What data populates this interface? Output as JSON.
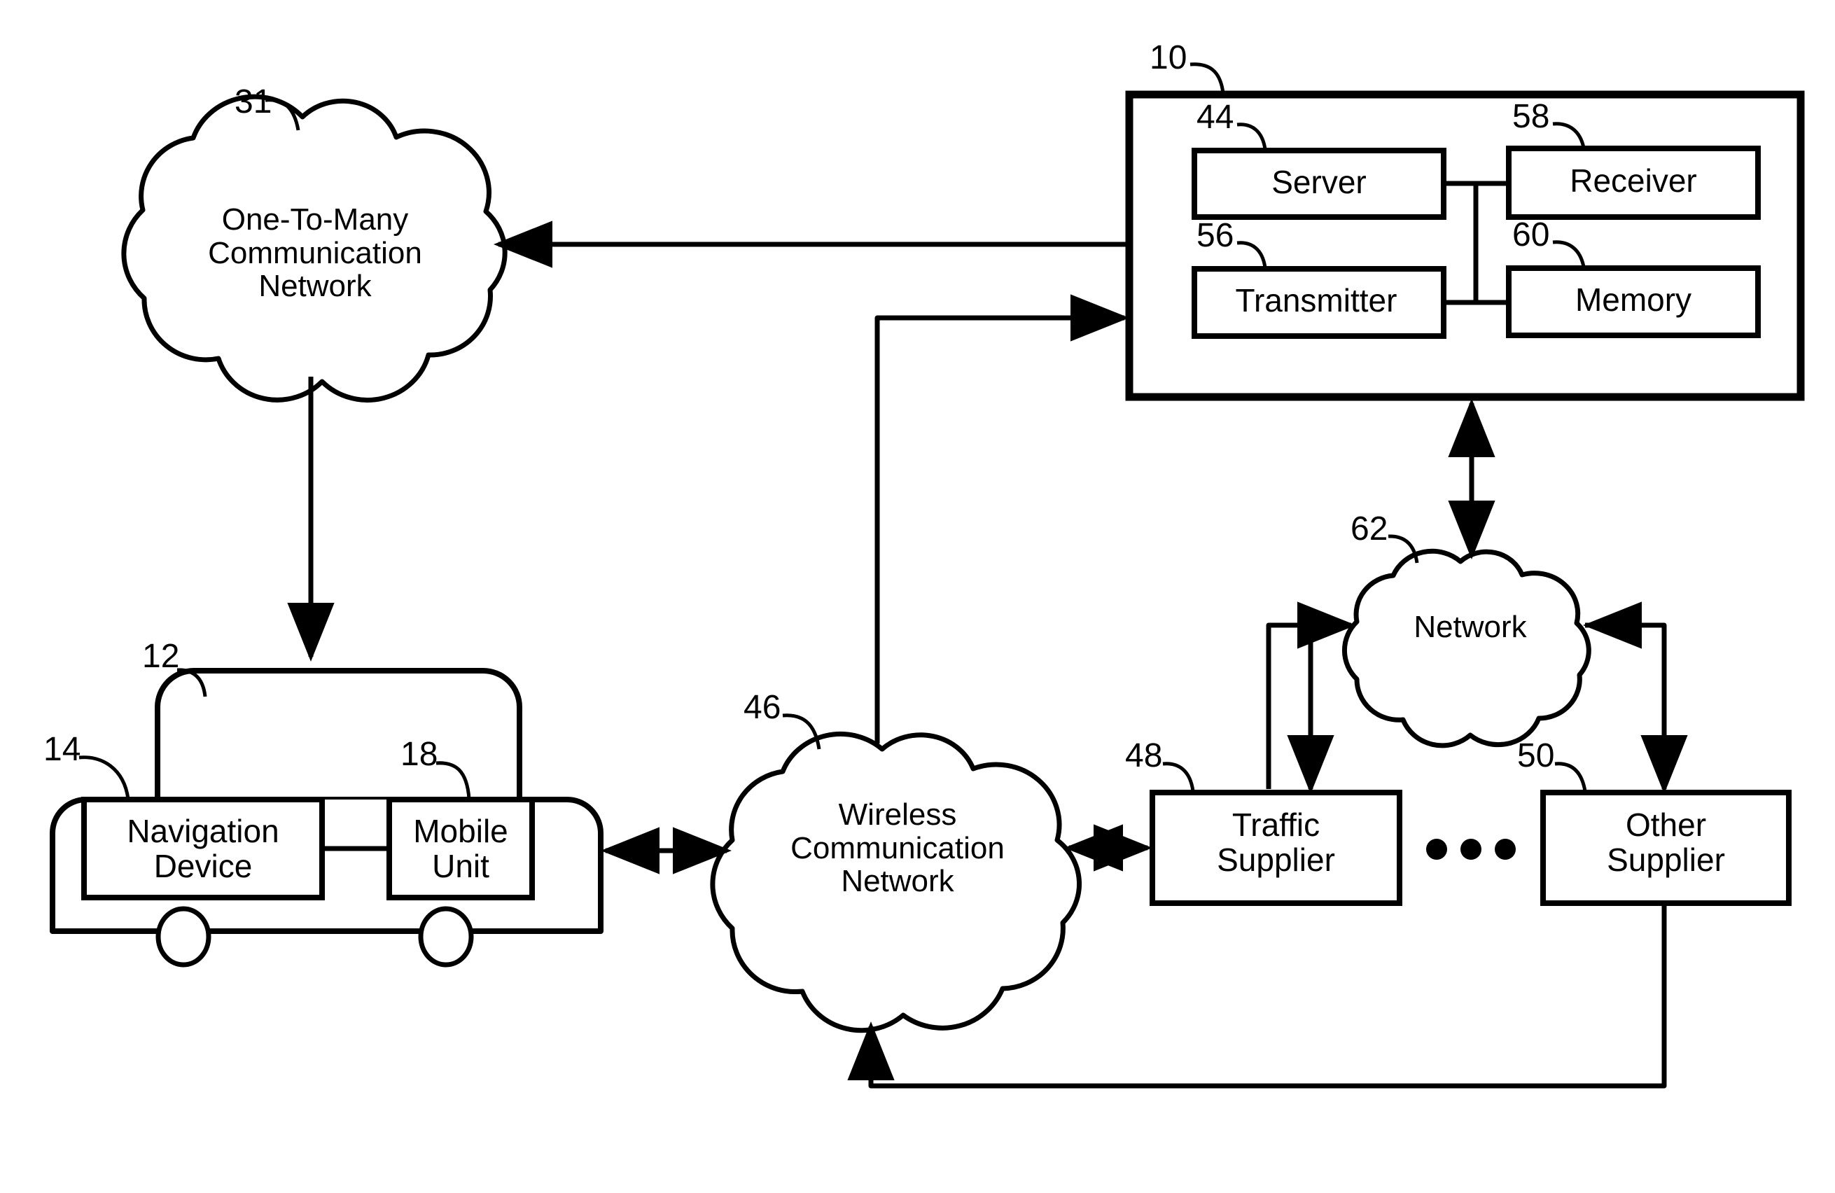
{
  "figure": {
    "type": "patent-block-diagram",
    "background_color": "#ffffff",
    "line_color": "#000000"
  },
  "nodes": {
    "one_to_many_cloud": {
      "ref": "31",
      "label": "One-To-Many\nCommunication\nNetwork",
      "shape": "cloud"
    },
    "vehicle": {
      "ref": "12",
      "label": "",
      "shape": "vehicle-outline"
    },
    "navigation_device": {
      "ref": "14",
      "label": "Navigation\nDevice",
      "shape": "rect"
    },
    "mobile_unit": {
      "ref": "18",
      "label": "Mobile\nUnit",
      "shape": "rect"
    },
    "wireless_cloud": {
      "ref": "46",
      "label": "Wireless\nCommunication\nNetwork",
      "shape": "cloud"
    },
    "traffic_supplier": {
      "ref": "48",
      "label": "Traffic\nSupplier",
      "shape": "rect"
    },
    "other_supplier": {
      "ref": "50",
      "label": "Other\nSupplier",
      "shape": "rect"
    },
    "network_cloud": {
      "ref": "62",
      "label": "Network",
      "shape": "cloud"
    },
    "system_box": {
      "ref": "10",
      "label": "",
      "shape": "rect-container"
    },
    "server": {
      "ref": "44",
      "label": "Server",
      "shape": "rect"
    },
    "receiver": {
      "ref": "58",
      "label": "Receiver",
      "shape": "rect"
    },
    "transmitter": {
      "ref": "56",
      "label": "Transmitter",
      "shape": "rect"
    },
    "memory": {
      "ref": "60",
      "label": "Memory",
      "shape": "rect"
    }
  },
  "ellipsis": {
    "label": "• • •",
    "between": [
      "traffic_supplier",
      "other_supplier"
    ]
  },
  "connections": [
    {
      "from": "system_box",
      "to": "one_to_many_cloud",
      "arrow": "single"
    },
    {
      "from": "one_to_many_cloud",
      "to": "vehicle",
      "arrow": "single"
    },
    {
      "from": "navigation_device",
      "to": "mobile_unit",
      "arrow": "none"
    },
    {
      "from": "vehicle",
      "to": "wireless_cloud",
      "arrow": "double"
    },
    {
      "from": "wireless_cloud",
      "to": "system_box",
      "arrow": "single"
    },
    {
      "from": "wireless_cloud",
      "to": "traffic_supplier",
      "arrow": "double"
    },
    {
      "from": "traffic_supplier",
      "to": "network_cloud",
      "arrow": "single"
    },
    {
      "from": "network_cloud",
      "to": "other_supplier",
      "arrow": "single"
    },
    {
      "from": "network_cloud",
      "to": "system_box",
      "arrow": "double"
    },
    {
      "from": "other_supplier",
      "to": "wireless_cloud",
      "arrow": "single"
    },
    {
      "from": "server",
      "to": "receiver",
      "arrow": "none"
    },
    {
      "from": "transmitter",
      "to": "memory",
      "arrow": "none"
    },
    {
      "from": "server",
      "to": "transmitter",
      "arrow": "none"
    }
  ]
}
